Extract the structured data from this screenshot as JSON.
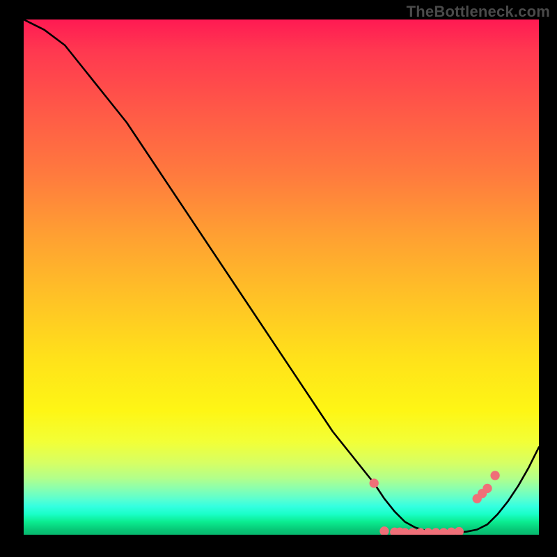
{
  "watermark": "TheBottleneck.com",
  "chart_data": {
    "type": "line",
    "title": "",
    "xlabel": "",
    "ylabel": "",
    "xlim": [
      0,
      100
    ],
    "ylim": [
      0,
      100
    ],
    "series": [
      {
        "name": "curve",
        "x": [
          0,
          4,
          8,
          12,
          16,
          20,
          24,
          28,
          32,
          36,
          40,
          44,
          48,
          52,
          56,
          60,
          64,
          68,
          70,
          72,
          74,
          76,
          78,
          80,
          82,
          84,
          86,
          88,
          90,
          92,
          94,
          96,
          98,
          100
        ],
        "y": [
          100,
          98,
          95,
          90,
          85,
          80,
          74,
          68,
          62,
          56,
          50,
          44,
          38,
          32,
          26,
          20,
          15,
          10,
          7,
          4.5,
          2.5,
          1.4,
          0.8,
          0.5,
          0.4,
          0.4,
          0.6,
          1.0,
          2.0,
          4.0,
          6.5,
          9.5,
          13,
          17
        ]
      }
    ],
    "markers": {
      "name": "highlighted-points",
      "color": "#ef6f78",
      "points": [
        {
          "x": 68,
          "y": 10
        },
        {
          "x": 70,
          "y": 0.7
        },
        {
          "x": 72,
          "y": 0.5
        },
        {
          "x": 73,
          "y": 0.5
        },
        {
          "x": 74,
          "y": 0.4
        },
        {
          "x": 75.5,
          "y": 0.4
        },
        {
          "x": 77,
          "y": 0.4
        },
        {
          "x": 78.5,
          "y": 0.4
        },
        {
          "x": 80,
          "y": 0.4
        },
        {
          "x": 81.5,
          "y": 0.4
        },
        {
          "x": 83,
          "y": 0.5
        },
        {
          "x": 84.5,
          "y": 0.6
        },
        {
          "x": 88,
          "y": 7.0
        },
        {
          "x": 89,
          "y": 8.0
        },
        {
          "x": 90,
          "y": 9.0
        },
        {
          "x": 91.5,
          "y": 11.5
        }
      ]
    },
    "gradient_stops": [
      {
        "pos": 0,
        "color": "#ff1a53"
      },
      {
        "pos": 0.5,
        "color": "#ffc226"
      },
      {
        "pos": 0.8,
        "color": "#f2ff37"
      },
      {
        "pos": 1.0,
        "color": "#07b86f"
      }
    ]
  }
}
